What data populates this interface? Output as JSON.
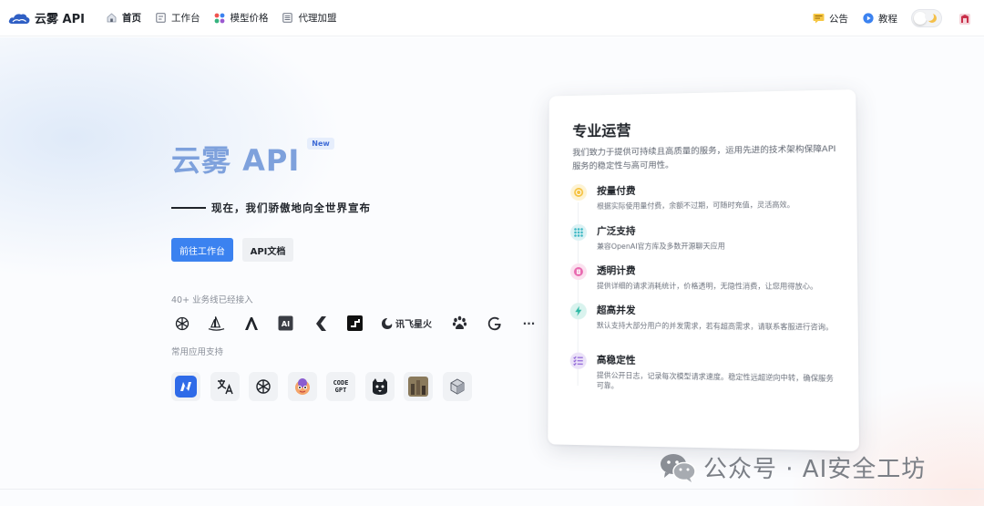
{
  "brand": {
    "name": "云雾 API"
  },
  "nav": {
    "items": [
      {
        "label": "首页",
        "icon": "home-icon"
      },
      {
        "label": "工作台",
        "icon": "console-icon"
      },
      {
        "label": "模型价格",
        "icon": "grid-dots-icon"
      },
      {
        "label": "代理加盟",
        "icon": "list-icon"
      }
    ],
    "right": [
      {
        "label": "公告",
        "icon": "announcement-icon"
      },
      {
        "label": "教程",
        "icon": "play-icon"
      }
    ]
  },
  "hero": {
    "title": "云雾 API",
    "badge": "New",
    "slogan": "现在，我们骄傲地向全世界宣布",
    "primary_button": "前往工作台",
    "secondary_button": "API文档",
    "models_label": "40+ 业务线已经接入",
    "models": [
      "openai-icon",
      "midjourney-icon",
      "anthropic-icon",
      "ai-box-icon",
      "claude-shape-icon",
      "stable-icon",
      "xunfei-icon",
      "baidu-paw-icon",
      "google-icon",
      "more-icon"
    ],
    "xunfei_text": "讯飞星火",
    "more": "···",
    "apps_label": "常用应用支持",
    "apps": [
      "nextchat-icon",
      "translate-icon",
      "chatgpt-icon",
      "mascot-icon",
      "codegpt-icon",
      "cat-icon",
      "scene-icon",
      "cube-icon"
    ],
    "codegpt_text": "CODE GPT"
  },
  "card": {
    "title": "专业运营",
    "description": "我们致力于提供可持续且高质量的服务，运用先进的技术架构保障API服务的稳定性与高可用性。",
    "features": [
      {
        "title": "按量付费",
        "desc": "根据实际使用量付费，余额不过期，可随时充值，灵活高效。",
        "icon": "coin-icon",
        "color": "#f5c342",
        "bg": "#fdf3d4"
      },
      {
        "title": "广泛支持",
        "desc": "兼容OpenAI官方库及多数开源聊天应用",
        "icon": "grid-icon",
        "color": "#3db8c4",
        "bg": "#dcf2f4"
      },
      {
        "title": "透明计费",
        "desc": "提供详细的请求消耗统计，价格透明，无隐性消费，让您用得放心。",
        "icon": "receipt-icon",
        "color": "#e86bb0",
        "bg": "#fbe1ef"
      },
      {
        "title": "超高并发",
        "desc": "默认支持大部分用户的并发需求，若有超高需求，请联系客服进行咨询。",
        "icon": "bolt-icon",
        "color": "#2fb9a5",
        "bg": "#d9f3ee"
      },
      {
        "title": "高稳定性",
        "desc": "提供公开日志，记录每次模型请求速度。稳定性远超逆向中转，确保服务可靠。",
        "icon": "checklist-icon",
        "color": "#8b5fd6",
        "bg": "#ebe2f8"
      }
    ]
  },
  "watermark": {
    "text": "公众号 · AI安全工坊"
  },
  "colors": {
    "primary": "#3b82f0",
    "title": "#7ea1dc"
  }
}
